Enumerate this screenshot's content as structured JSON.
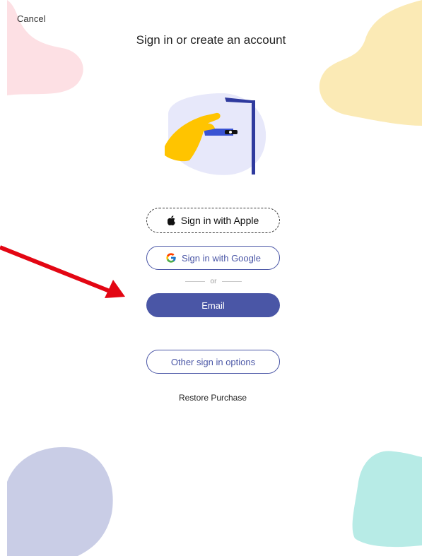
{
  "header": {
    "cancel_label": "Cancel",
    "title": "Sign in or create an account"
  },
  "buttons": {
    "apple_label": "Sign in with Apple",
    "google_label": "Sign in with Google",
    "divider_text": "or",
    "email_label": "Email",
    "other_label": "Other sign in options",
    "restore_label": "Restore Purchase"
  },
  "icons": {
    "apple": "apple-icon",
    "google": "google-icon",
    "hero": "sign-in-illustration",
    "annotation": "red-arrow"
  },
  "colors": {
    "primary": "#4a56a6",
    "annotation_arrow": "#e30613",
    "blob_pink": "#fde0e4",
    "blob_yellow": "#fbeab5",
    "blob_purple": "#c9cde6",
    "blob_teal": "#b7ebe6"
  }
}
